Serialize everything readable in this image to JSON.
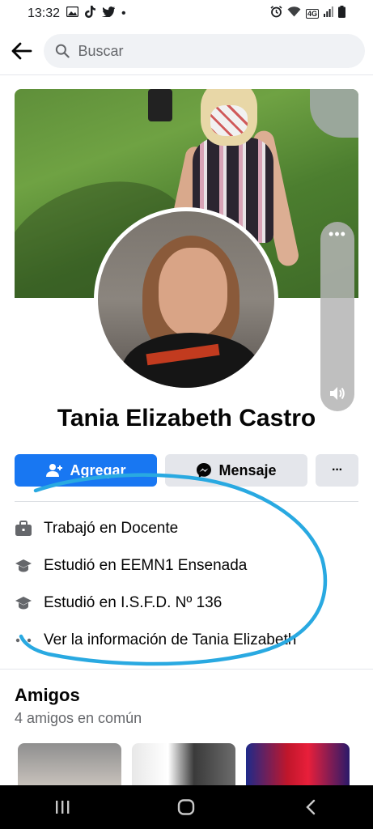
{
  "status_bar": {
    "time": "13:32",
    "dot": "•",
    "network": "4G"
  },
  "search": {
    "placeholder": "Buscar"
  },
  "profile": {
    "name": "Tania Elizabeth Castro"
  },
  "actions": {
    "add_label": "Agregar",
    "message_label": "Mensaje",
    "more_label": "···"
  },
  "info": [
    {
      "icon": "briefcase-icon",
      "text": "Trabajó en Docente"
    },
    {
      "icon": "graduation-cap-icon",
      "text": "Estudió en EEMN1 Ensenada"
    },
    {
      "icon": "graduation-cap-icon",
      "text": "Estudió en I.S.F.D. Nº 136"
    },
    {
      "icon": "more-dots-icon",
      "text": "Ver la información de Tania Elizabeth"
    }
  ],
  "friends": {
    "title": "Amigos",
    "subtitle": "4 amigos en común"
  },
  "volume": {
    "menu": "•••"
  },
  "colors": {
    "accent": "#1877f2",
    "scribble": "#29a9e1",
    "secondary_bg": "#e4e6eb",
    "muted_text": "#65676b"
  }
}
